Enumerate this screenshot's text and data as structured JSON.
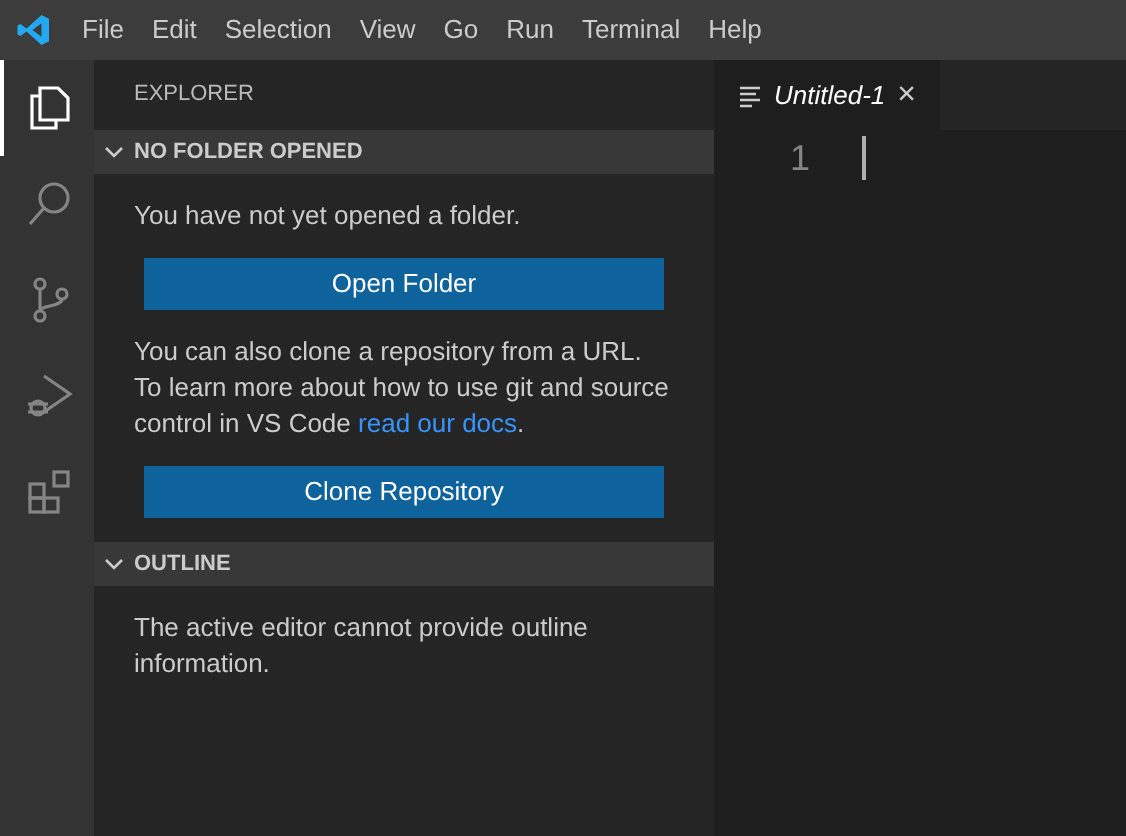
{
  "menu": [
    "File",
    "Edit",
    "Selection",
    "View",
    "Go",
    "Run",
    "Terminal",
    "Help"
  ],
  "activity_bar": [
    {
      "kind": "files",
      "selected": true
    },
    {
      "kind": "search",
      "selected": false
    },
    {
      "kind": "source-control",
      "selected": false
    },
    {
      "kind": "run",
      "selected": false
    },
    {
      "kind": "extensions",
      "selected": false
    }
  ],
  "sidebar": {
    "title": "EXPLORER",
    "sections": [
      {
        "title": "NO FOLDER OPENED",
        "expanded": true,
        "blocks": [
          {
            "kind": "text",
            "text": "You have not yet opened a folder."
          },
          {
            "kind": "button",
            "label": "Open Folder"
          },
          {
            "kind": "text",
            "text": "You can also clone a repository from a URL. To learn more about how to use git and source control in VS Code",
            "link": "read our docs",
            "after": "."
          },
          {
            "kind": "button",
            "label": "Clone Repository"
          }
        ]
      },
      {
        "title": "OUTLINE",
        "expanded": true,
        "blocks": [
          {
            "kind": "text",
            "text": "The active editor cannot provide outline information."
          }
        ]
      }
    ]
  },
  "editor": {
    "tabs": [
      {
        "title": "Untitled-1",
        "selected": true,
        "close": "×"
      }
    ],
    "line_numbers": [
      "1"
    ]
  }
}
